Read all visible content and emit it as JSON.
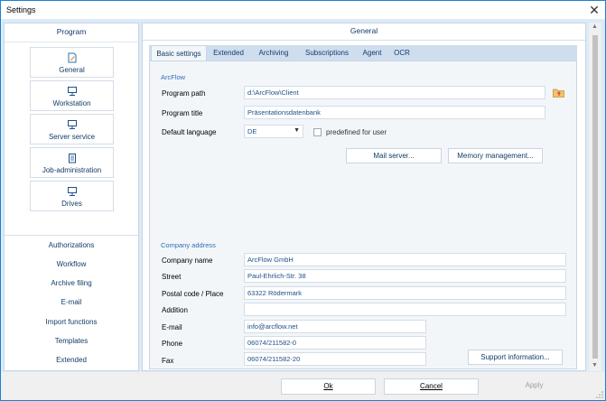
{
  "window": {
    "title": "Settings"
  },
  "sidebar": {
    "header": "Program",
    "buttons": [
      {
        "label": "General",
        "icon": "document-edit-icon"
      },
      {
        "label": "Workstation",
        "icon": "computer-icon"
      },
      {
        "label": "Server service",
        "icon": "server-icon"
      },
      {
        "label": "Job-administration",
        "icon": "clipboard-icon"
      },
      {
        "label": "Drives",
        "icon": "drive-icon"
      }
    ],
    "links": [
      "Authorizations",
      "Workflow",
      "Archive filing",
      "E-mail",
      "Import functions",
      "Templates",
      "Extended"
    ]
  },
  "content": {
    "header": "General",
    "tabs": [
      "Basic settings",
      "Extended",
      "Archiving",
      "Subscriptions",
      "Agent",
      "OCR"
    ],
    "active_tab": "Basic settings",
    "arcflow": {
      "section": "ArcFlow",
      "program_path_label": "Program path",
      "program_path": "d:\\ArcFlow\\Client",
      "program_title_label": "Program title",
      "program_title": "Präsentationsdatenbank",
      "default_language_label": "Default language",
      "default_language": "DE",
      "predefined_label": "predefined for user",
      "mail_server_button": "Mail server...",
      "memory_button": "Memory management..."
    },
    "company": {
      "section": "Company address",
      "name_label": "Company name",
      "name": "ArcFlow GmbH",
      "street_label": "Street",
      "street": "Paul-Ehrlich-Str. 38",
      "postal_label": "Postal code / Place",
      "postal": "63322 Rödermark",
      "addition_label": "Addition",
      "addition": "",
      "email_label": "E-mail",
      "email": "info@arcflow.net",
      "phone_label": "Phone",
      "phone": "06074/211582-0",
      "fax_label": "Fax",
      "fax": "06074/211582-20",
      "support_button": "Support information..."
    }
  },
  "footer": {
    "ok": "Ok",
    "cancel": "Cancel",
    "apply": "Apply"
  },
  "colors": {
    "accent": "#1883d7",
    "text_blue": "#123c69",
    "section_blue": "#2a6fb8",
    "panel_bg": "#ddeaf7"
  }
}
